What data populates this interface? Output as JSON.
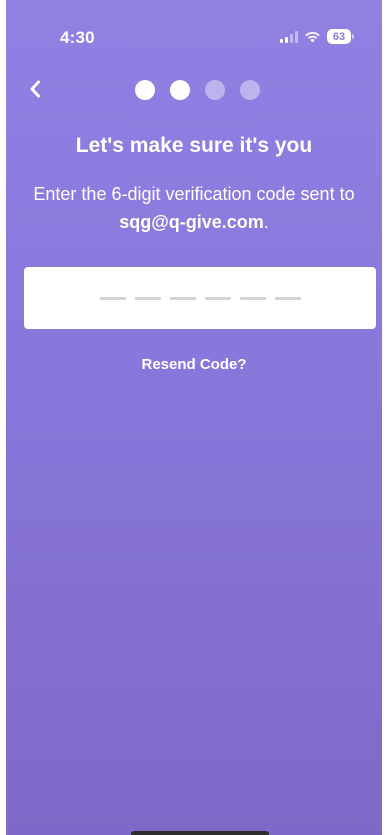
{
  "status_bar": {
    "time": "4:30",
    "battery": "63",
    "icons": [
      "signal-icon",
      "wifi-icon",
      "battery-icon"
    ]
  },
  "nav": {
    "back_icon": "chevron-left-icon",
    "steps_total": 4,
    "current_step": 2
  },
  "verification": {
    "title": "Let's make sure it's you",
    "subtitle_prefix": "Enter the 6-digit verification code sent to ",
    "email": "sqg@q-give.com",
    "subtitle_suffix": ".",
    "code_length": 6,
    "code_value": "",
    "resend_label": "Resend Code?"
  },
  "colors": {
    "background_top": "#8f82e3",
    "background_bottom": "#7f69c8",
    "text": "#ffffff",
    "input_bg": "#ffffff",
    "placeholder_dash": "#d3d3d3"
  }
}
